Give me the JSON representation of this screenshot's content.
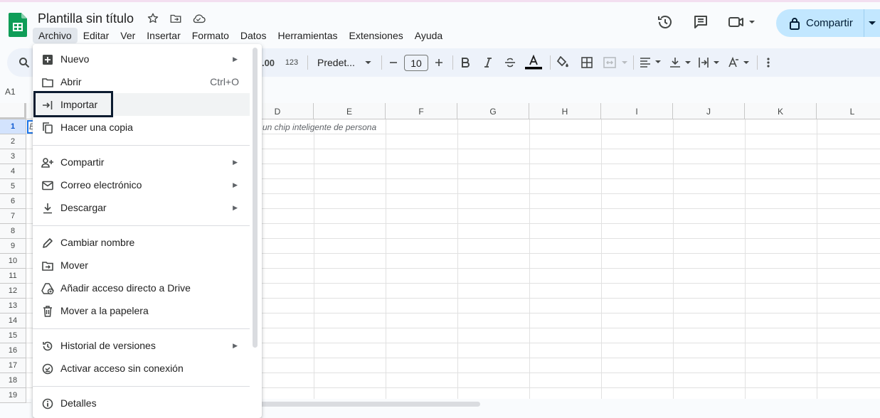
{
  "header": {
    "title": "Plantilla sin título",
    "share_label": "Compartir"
  },
  "menubar": [
    "Archivo",
    "Editar",
    "Ver",
    "Insertar",
    "Formato",
    "Datos",
    "Herramientas",
    "Extensiones",
    "Ayuda"
  ],
  "toolbar": {
    "decimal_label": ".00",
    "number_format_label": "123",
    "font_name": "Predet...",
    "font_size": "10"
  },
  "formula_bar": {
    "name_box": "A1"
  },
  "grid": {
    "columns": [
      "D",
      "E",
      "F",
      "G",
      "H",
      "I",
      "J",
      "K",
      "L"
    ],
    "rows": [
      "1",
      "2",
      "3",
      "4",
      "5",
      "6",
      "7",
      "8",
      "9",
      "10",
      "11",
      "12",
      "13",
      "14",
      "15",
      "16",
      "17",
      "18",
      "19"
    ],
    "cell_a1_fragment": "E",
    "cell_d1_text": "un chip inteligente de persona"
  },
  "file_menu": {
    "items": [
      {
        "label": "Nuevo",
        "icon": "plus-square-icon",
        "submenu": true
      },
      {
        "label": "Abrir",
        "icon": "folder-icon",
        "shortcut": "Ctrl+O"
      },
      {
        "label": "Importar",
        "icon": "import-icon"
      },
      {
        "label": "Hacer una copia",
        "icon": "copy-icon"
      },
      {
        "label": "Compartir",
        "icon": "person-add-icon",
        "submenu": true
      },
      {
        "label": "Correo electrónico",
        "icon": "mail-icon",
        "submenu": true
      },
      {
        "label": "Descargar",
        "icon": "download-icon",
        "submenu": true
      },
      {
        "label": "Cambiar nombre",
        "icon": "pencil-icon"
      },
      {
        "label": "Mover",
        "icon": "move-folder-icon"
      },
      {
        "label": "Añadir acceso directo a Drive",
        "icon": "drive-shortcut-icon"
      },
      {
        "label": "Mover a la papelera",
        "icon": "trash-icon"
      },
      {
        "label": "Historial de versiones",
        "icon": "history-icon",
        "submenu": true
      },
      {
        "label": "Activar acceso sin conexión",
        "icon": "offline-icon"
      },
      {
        "label": "Detalles",
        "icon": "info-icon"
      }
    ],
    "highlighted_item": "Importar"
  },
  "colors": {
    "sheets_green": "#0f9d58",
    "share_bg": "#c2e7ff",
    "toolbar_bg": "#edf2fa",
    "focus_outline": "#0c1c30"
  }
}
